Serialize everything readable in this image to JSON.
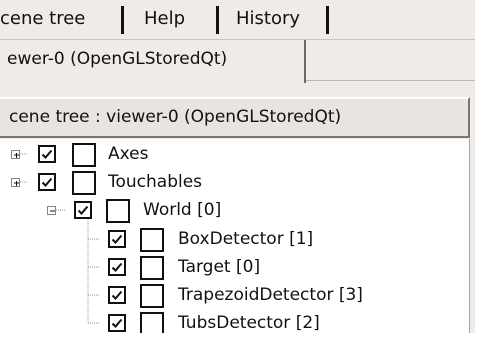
{
  "menu": {
    "items": [
      {
        "label": "cene tree"
      },
      {
        "label": "Help"
      },
      {
        "label": "History"
      }
    ]
  },
  "tabs": {
    "active_label": "ewer-0 (OpenGLStoredQt)"
  },
  "scene_tree": {
    "header_label": "cene tree : viewer-0 (OpenGLStoredQt)",
    "nodes": [
      {
        "label": "Axes",
        "checked": true,
        "expander": "collapsed"
      },
      {
        "label": "Touchables",
        "checked": true,
        "expander": "collapsed"
      },
      {
        "label": "World [0]",
        "checked": true,
        "expander": "expanded"
      },
      {
        "label": "BoxDetector [1]",
        "checked": true
      },
      {
        "label": "Target [0]",
        "checked": true
      },
      {
        "label": "TrapezoidDetector [3]",
        "checked": true
      },
      {
        "label": "TubsDetector [2]",
        "checked": true
      }
    ]
  }
}
